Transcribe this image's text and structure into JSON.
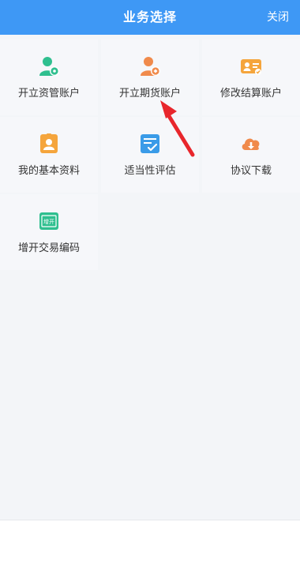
{
  "header": {
    "title": "业务选择",
    "close_label": "关闭"
  },
  "tiles": [
    {
      "label": "开立资管账户",
      "icon": "user-add-icon",
      "color": "#2fbf8f"
    },
    {
      "label": "开立期货账户",
      "icon": "user-add-icon",
      "color": "#f08a4b"
    },
    {
      "label": "修改结算账户",
      "icon": "account-card-icon",
      "color": "#f5a53c"
    },
    {
      "label": "我的基本资料",
      "icon": "profile-card-icon",
      "color": "#f5a53c"
    },
    {
      "label": "适当性评估",
      "icon": "checklist-icon",
      "color": "#3a9be8"
    },
    {
      "label": "协议下载",
      "icon": "cloud-download-icon",
      "color": "#f08a4b"
    },
    {
      "label": "增开交易编码",
      "icon": "new-badge-icon",
      "color": "#2fbf8f",
      "badge_text": "增开"
    }
  ],
  "colors": {
    "header_bg": "#3e98f5",
    "arrow": "#e8262c"
  }
}
